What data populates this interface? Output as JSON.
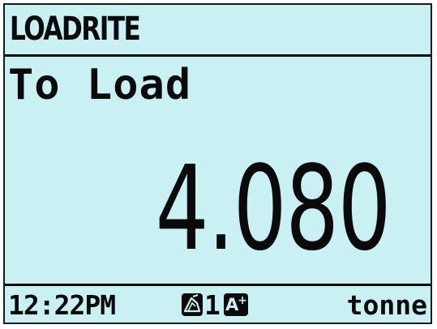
{
  "header": {
    "brand": "LOADRITE"
  },
  "main": {
    "mode_label": "To Load",
    "value": "4.080"
  },
  "status_bar": {
    "time": "12:22PM",
    "bucket_icon": "bucket-icon",
    "bucket_number": "1",
    "auto_add_icon_letter": "A",
    "auto_add_icon_mark": "+",
    "unit": "tonne"
  },
  "colors": {
    "screen_background": "#c9f0f2",
    "foreground": "#0a0a0a"
  }
}
